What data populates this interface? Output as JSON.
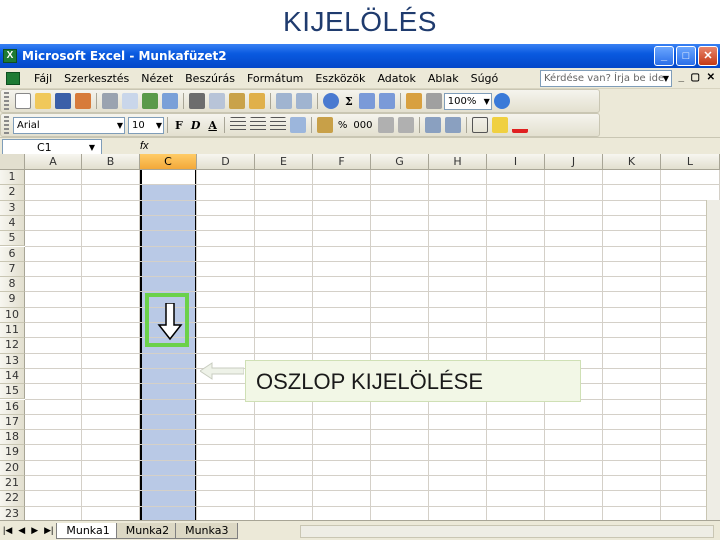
{
  "slide": {
    "title": "KIJELÖLÉS"
  },
  "window": {
    "title": "Microsoft Excel - Munkafüzet2",
    "app_icon_letter": "X"
  },
  "menu": {
    "items": [
      "Fájl",
      "Szerkesztés",
      "Nézet",
      "Beszúrás",
      "Formátum",
      "Eszközök",
      "Adatok",
      "Ablak",
      "Súgó"
    ],
    "help_placeholder": "Kérdése van? Írja be ide."
  },
  "standard_toolbar": {
    "zoom": "100%",
    "sigma": "Σ"
  },
  "formatting_toolbar": {
    "font": "Arial",
    "size": "10",
    "bold": "F",
    "italic": "D",
    "underline": "A",
    "percent": "%",
    "thousands": "000"
  },
  "formula_bar": {
    "name_box": "C1",
    "fx": "fx"
  },
  "grid": {
    "columns": [
      "A",
      "B",
      "C",
      "D",
      "E",
      "F",
      "G",
      "H",
      "I",
      "J",
      "K",
      "L"
    ],
    "rows": [
      "1",
      "2",
      "3",
      "4",
      "5",
      "6",
      "7",
      "8",
      "9",
      "10",
      "11",
      "12",
      "13",
      "14",
      "15",
      "16",
      "17",
      "18",
      "19",
      "20",
      "21",
      "22",
      "23"
    ],
    "selected_column": "C"
  },
  "callout": {
    "text": "OSZLOP KIJELÖLÉSE"
  },
  "sheets": {
    "tabs": [
      "Munka1",
      "Munka2",
      "Munka3"
    ],
    "active": "Munka1"
  },
  "colors": {
    "selection": "#b9c9e6",
    "highlight_box": "#6bd14a",
    "title_bar": "#0a5ae0"
  }
}
